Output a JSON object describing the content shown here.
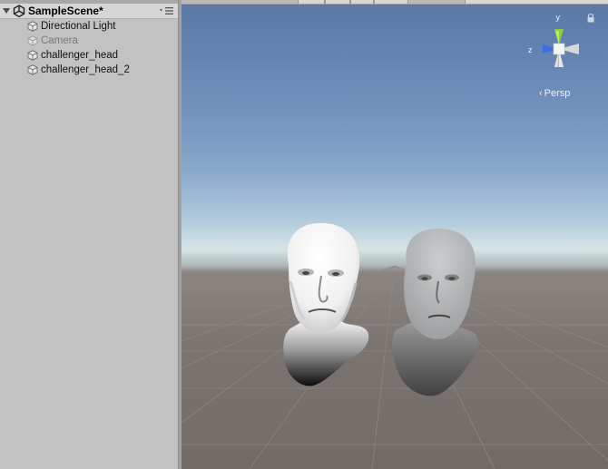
{
  "hierarchy": {
    "scene_name": "SampleScene*",
    "items": [
      {
        "label": "Directional Light",
        "enabled": true
      },
      {
        "label": "Camera",
        "enabled": false
      },
      {
        "label": "challenger_head",
        "enabled": true
      },
      {
        "label": "challenger_head_2",
        "enabled": true
      }
    ]
  },
  "scene_view": {
    "projection_label": "Persp",
    "gizmo_axes": {
      "y": "y",
      "z": "z"
    },
    "colors": {
      "gizmo_y": "#8ecf3a",
      "gizmo_z": "#3a6fe0",
      "gizmo_x": "#d8d8d8",
      "sky_top": "#5a78a6",
      "horizon": "#d6e4e6",
      "ground": "#7b7470"
    }
  }
}
